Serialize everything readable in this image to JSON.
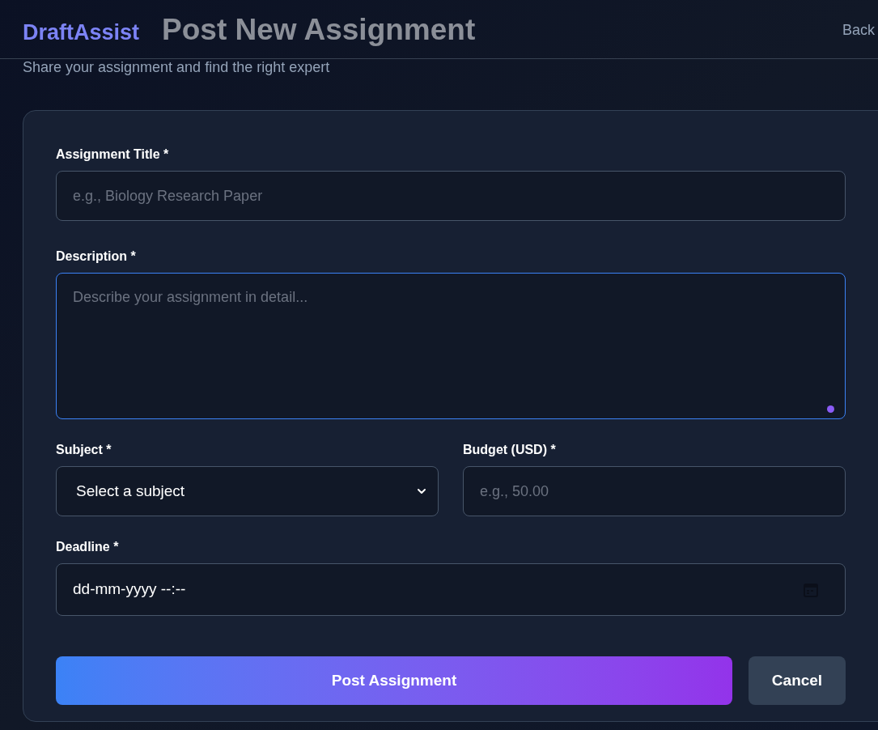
{
  "header": {
    "logo": "DraftAssist",
    "back_link": "Back"
  },
  "page": {
    "title": "Post New Assignment",
    "subtitle": "Share your assignment and find the right expert"
  },
  "form": {
    "fields": [
      {
        "kind": "text",
        "label": "Assignment Title *",
        "placeholder": "e.g., Biology Research Paper",
        "focused": false
      },
      {
        "kind": "textarea",
        "label": "Description *",
        "placeholder": "Describe your assignment in detail...",
        "focused": true
      },
      {
        "kind": "select",
        "label": "Subject *",
        "value": "Select a subject",
        "focused": false
      },
      {
        "kind": "text",
        "label": "Budget (USD) *",
        "placeholder": "e.g., 50.00",
        "focused": false
      },
      {
        "kind": "datetime",
        "label": "Deadline *",
        "value": "dd-mm-yyyy --:--",
        "focused": false
      }
    ],
    "buttons": [
      {
        "kind": "primary",
        "label": "Post Assignment"
      },
      {
        "kind": "secondary",
        "label": "Cancel"
      }
    ]
  }
}
